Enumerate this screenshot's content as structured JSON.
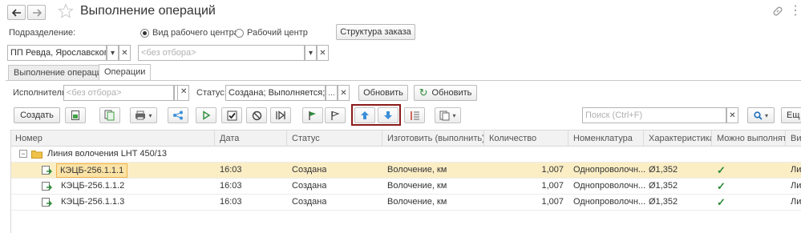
{
  "window": {
    "title": "Выполнение операций"
  },
  "filters": {
    "division_label": "Подразделение:",
    "mode_option_1": "Вид рабочего центра",
    "mode_option_2": "Рабочий центр",
    "order_structure_button": "Структура заказа",
    "division_value": "ПП Ревда, Ярославского",
    "no_filter_placeholder": "<без отбора>"
  },
  "tabs": [
    "Выполнение операций",
    "Операции"
  ],
  "filters2": {
    "executor_label": "Исполнитель:",
    "executor_placeholder": "<без отбора>",
    "status_label": "Статус:",
    "status_value": "Создана; Выполняется; Не",
    "ellipsis": "...",
    "refresh_label": "Обновить",
    "refresh2_label": "Обновить"
  },
  "toolbar": {
    "create_label": "Создать",
    "search_placeholder": "Поиск (Ctrl+F)",
    "more_label": "Ещ"
  },
  "grid": {
    "columns": [
      "Номер",
      "Дата",
      "Статус",
      "Изготовить (выполнить)",
      "Количество",
      "Номенклатура",
      "Характеристика",
      "Можно выполнять",
      "Ви"
    ],
    "group_label": "Линия волочения LHT 450/13",
    "rows": [
      {
        "number": "КЭЦБ-256.1.1.1",
        "date": "16:03",
        "status": "Создана",
        "make": "Волочение, км",
        "qty": "1,007",
        "nomenclature": "Однопроволочн...",
        "characteristic": "Ø1,352",
        "can_do": "✓",
        "extra": "Ли"
      },
      {
        "number": "КЭЦБ-256.1.1.2",
        "date": "16:03",
        "status": "Создана",
        "make": "Волочение, км",
        "qty": "1,007",
        "nomenclature": "Однопроволочн...",
        "characteristic": "Ø1,352",
        "can_do": "✓",
        "extra": "Ли"
      },
      {
        "number": "КЭЦБ-256.1.1.3",
        "date": "16:03",
        "status": "Создана",
        "make": "Волочение, км",
        "qty": "1,007",
        "nomenclature": "Однопроволочн...",
        "characteristic": "Ø1,352",
        "can_do": "✓",
        "extra": "Ли"
      }
    ]
  },
  "colors": {
    "accent_green": "#2e8b3a",
    "highlight_border": "#8b1a1a",
    "selected_row": "#fbeec5",
    "arrow_blue": "#3b8fd9"
  }
}
